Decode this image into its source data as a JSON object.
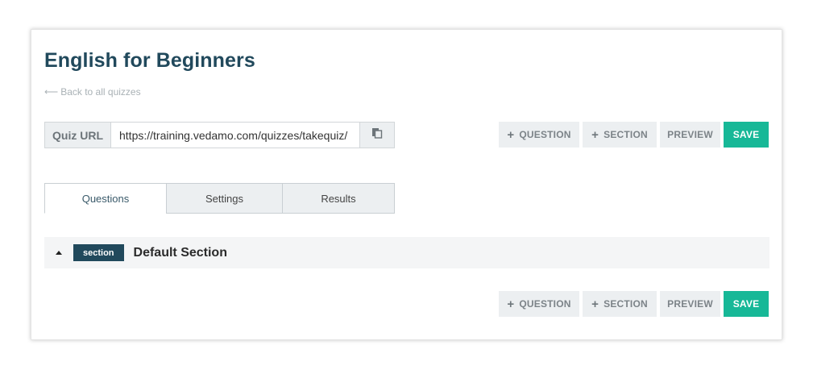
{
  "page": {
    "title": "English for Beginners",
    "back_link": "Back to all quizzes"
  },
  "url": {
    "label": "Quiz URL",
    "value": "https://training.vedamo.com/quizzes/takequiz/"
  },
  "toolbar": {
    "question_label": "Question",
    "section_label": "Section",
    "preview_label": "Preview",
    "save_label": "Save"
  },
  "tabs": [
    {
      "label": "Questions",
      "active": true
    },
    {
      "label": "Settings",
      "active": false
    },
    {
      "label": "Results",
      "active": false
    }
  ],
  "section": {
    "badge": "section",
    "name": "Default Section"
  },
  "colors": {
    "accent": "#17b897",
    "brand": "#21495c"
  },
  "icons": {
    "back": "arrow-left-icon",
    "copy": "copy-icon",
    "add": "plus-icon",
    "collapse": "caret-up-icon"
  }
}
